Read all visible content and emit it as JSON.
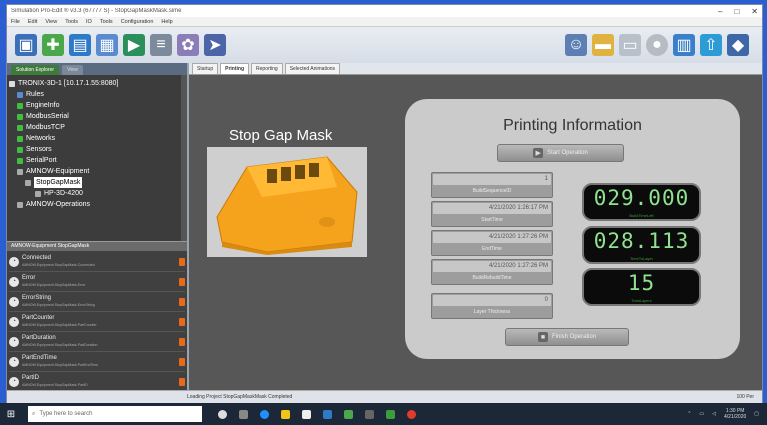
{
  "window": {
    "title": "Simulation Pro-Edit ® v3.3 (67777 S) - StopGapMaskMask.sime"
  },
  "menu": [
    "File",
    "Edit",
    "View",
    "Tools",
    "IO",
    "Tools",
    "Configuration",
    "Help"
  ],
  "toolbar": {
    "left_icons": [
      "cube-icon",
      "nodes-icon",
      "save-icon",
      "open-icon",
      "run-icon",
      "graph-icon",
      "settings-icon",
      "arrow-icon"
    ],
    "right_icons": [
      "users-icon",
      "folder-icon",
      "screen-icon",
      "disc-icon",
      "chart-icon",
      "upload-icon",
      "cube-icon"
    ]
  },
  "left_panel": {
    "tabs": [
      "Solution Explorer",
      "View"
    ],
    "tree": [
      {
        "label": "TRONIX-3D-1 [10.17.1.55:8080]",
        "indent": 0
      },
      {
        "label": "Rules",
        "indent": 1
      },
      {
        "label": "EngineInfo",
        "indent": 1
      },
      {
        "label": "ModbusSerial",
        "indent": 1
      },
      {
        "label": "ModbusTCP",
        "indent": 1
      },
      {
        "label": "Networks",
        "indent": 1
      },
      {
        "label": "Sensors",
        "indent": 1
      },
      {
        "label": "SerialPort",
        "indent": 1
      },
      {
        "label": "AMNOW-Equipment",
        "indent": 1
      },
      {
        "label": "StopGapMask",
        "indent": 2,
        "selected": true
      },
      {
        "label": "HP-3D-4200",
        "indent": 3
      },
      {
        "label": "AMNOW-Operations",
        "indent": 1
      }
    ],
    "sub_header": "AMNOW-Equipment StopGapMask",
    "properties": [
      {
        "name": "Connected",
        "sub": "AMNOW-Equipment.StopGapMask.Connected"
      },
      {
        "name": "Error",
        "sub": "AMNOW-Equipment.StopGapMask.Error"
      },
      {
        "name": "ErrorString",
        "sub": "AMNOW-Equipment.StopGapMask.ErrorString"
      },
      {
        "name": "PartCounter",
        "sub": "AMNOW-Equipment.StopGapMask.PartCounter"
      },
      {
        "name": "PartDuration",
        "sub": "AMNOW-Equipment.StopGapMask.PartDuration"
      },
      {
        "name": "PartEndTime",
        "sub": "AMNOW-Equipment.StopGapMask.PartEndTime"
      },
      {
        "name": "PartID",
        "sub": "AMNOW-Equipment.StopGapMask.PartID"
      }
    ]
  },
  "doc_tabs": [
    "Startup",
    "Printing",
    "Reporting",
    "Selected Animations"
  ],
  "canvas": {
    "mask_title": "Stop Gap Mask",
    "info_title": "Printing Information",
    "start_button": "Start Operation",
    "finish_button": "Finish Operation",
    "fields": [
      {
        "value": "1",
        "label": "BuildSequenceID"
      },
      {
        "value": "4/21/2020 1:26:17 PM",
        "label": "StartTime"
      },
      {
        "value": "4/21/2020 1:27:26 PM",
        "label": "EndTime"
      },
      {
        "value": "4/21/2020 1:27:26 PM",
        "label": "BuildRebuildTime"
      },
      {
        "value": "0",
        "label": "Layer Thickness"
      }
    ],
    "displays": [
      {
        "value": "029.000",
        "label": "BuildTimeLeft"
      },
      {
        "value": "028.113",
        "label": "TimeToLayer"
      },
      {
        "value": "15",
        "label": "TotalLayers"
      }
    ]
  },
  "status": {
    "text": "Loading Project StopGapMaskMask Completed",
    "zoom": "100 Per"
  },
  "taskbar": {
    "search_placeholder": "Type here to search",
    "time": "1:30 PM",
    "date": "4/21/2020"
  },
  "colors": {
    "accent_green": "#3fbf3f",
    "lcd_green": "#8fe38f",
    "mask_orange": "#f5a21d"
  }
}
